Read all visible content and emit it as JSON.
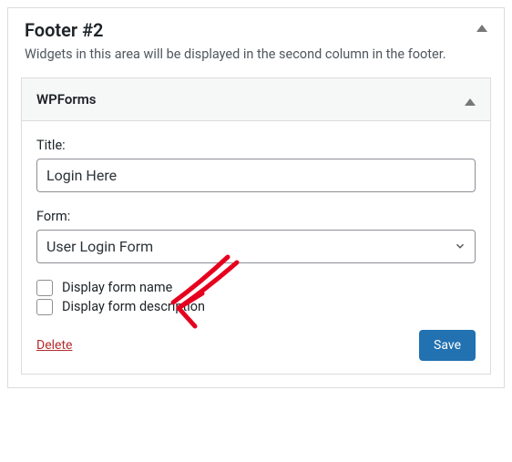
{
  "outer": {
    "title": "Footer #2",
    "description": "Widgets in this area will be displayed in the second column in the footer."
  },
  "widget": {
    "name": "WPForms",
    "title_label": "Title:",
    "title_value": "Login Here",
    "form_label": "Form:",
    "form_value": "User Login Form",
    "check_name_label": "Display form name",
    "check_desc_label": "Display form description",
    "delete_label": "Delete",
    "save_label": "Save"
  }
}
